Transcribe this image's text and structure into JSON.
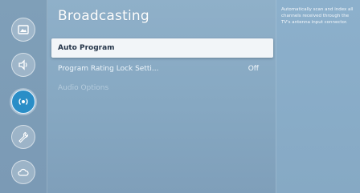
{
  "sidebar": {
    "items": [
      {
        "icon": "picture-icon",
        "active": false
      },
      {
        "icon": "sound-icon",
        "active": false
      },
      {
        "icon": "broadcasting-icon",
        "active": true
      },
      {
        "icon": "general-wrench-icon",
        "active": false
      },
      {
        "icon": "support-cloud-icon",
        "active": false
      }
    ]
  },
  "main": {
    "title": "Broadcasting",
    "items": [
      {
        "label": "Auto Program",
        "value": "",
        "state": "focused"
      },
      {
        "label": "Program Rating Lock Setti...",
        "value": "Off",
        "state": "normal"
      },
      {
        "label": "Audio Options",
        "value": "",
        "state": "disabled"
      }
    ]
  },
  "help": {
    "text": "Automatically scan and index all channels received through the TV's antenna input connector."
  },
  "colors": {
    "accent": "#2a8ec7",
    "focus_bg": "#f2f5f8",
    "background": "#8aa6bd"
  }
}
